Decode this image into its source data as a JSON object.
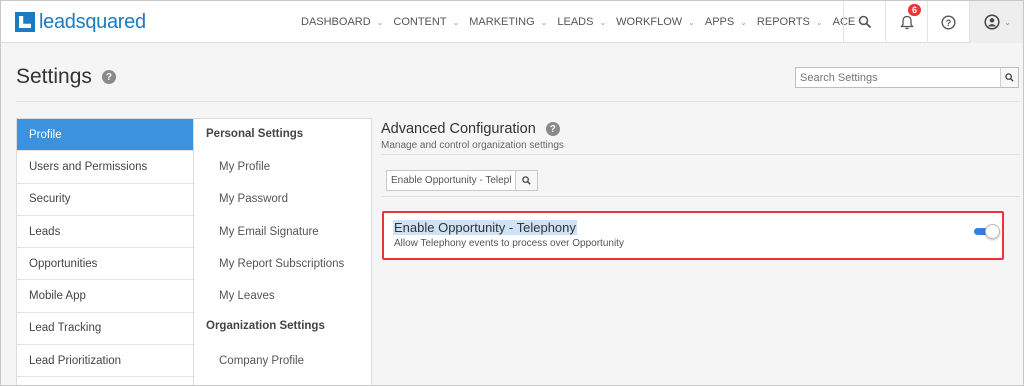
{
  "app": {
    "logo_text": "leadsquared",
    "brand_color": "#1a7bc1"
  },
  "nav": {
    "items": [
      {
        "label": "DASHBOARD"
      },
      {
        "label": "CONTENT"
      },
      {
        "label": "MARKETING"
      },
      {
        "label": "LEADS"
      },
      {
        "label": "WORKFLOW"
      },
      {
        "label": "APPS"
      },
      {
        "label": "REPORTS"
      },
      {
        "label": "ACE"
      }
    ],
    "notification_count": "6",
    "icons": [
      "search-icon",
      "bell-icon",
      "help-icon",
      "user-icon"
    ]
  },
  "header": {
    "title": "Settings",
    "help_glyph": "?",
    "search_placeholder": "Search Settings"
  },
  "left_menu": {
    "active_color": "#3b93e0",
    "items": [
      {
        "label": "Profile"
      },
      {
        "label": "Users and Permissions"
      },
      {
        "label": "Security"
      },
      {
        "label": "Leads"
      },
      {
        "label": "Opportunities"
      },
      {
        "label": "Mobile App"
      },
      {
        "label": "Lead Tracking"
      },
      {
        "label": "Lead Prioritization"
      }
    ]
  },
  "middle_menu": {
    "personal_header": "Personal Settings",
    "personal_items": [
      {
        "label": "My Profile"
      },
      {
        "label": "My Password"
      },
      {
        "label": "My Email Signature"
      },
      {
        "label": "My Report Subscriptions"
      },
      {
        "label": "My Leaves"
      }
    ],
    "org_header": "Organization Settings",
    "org_items": [
      {
        "label": "Company Profile"
      }
    ]
  },
  "advanced": {
    "title": "Advanced Configuration",
    "subtitle": "Manage and control organization settings",
    "filter_value": "Enable Opportunity - Telephony",
    "setting": {
      "title": "Enable Opportunity - Telephony",
      "description": "Allow Telephony events to process over Opportunity",
      "enabled": true
    },
    "highlight_color": "#e5363b"
  }
}
